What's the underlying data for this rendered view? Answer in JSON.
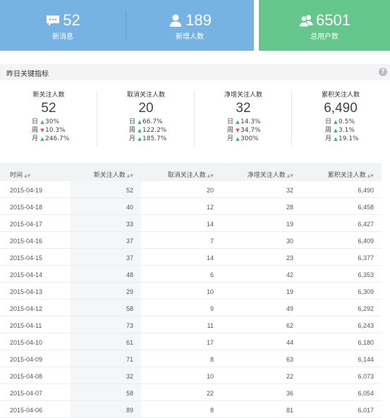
{
  "top_cards": [
    {
      "icon": "message-icon",
      "value": "52",
      "label": "新消息"
    },
    {
      "icon": "user-icon",
      "value": "189",
      "label": "新增人数"
    },
    {
      "icon": "users-icon",
      "value": "6501",
      "label": "总用户数"
    }
  ],
  "colors": {
    "blue_card": "#76b3e2",
    "green_card": "#66c78c",
    "up": "#3cb36b",
    "down": "#e04b4b"
  },
  "kpi_section": {
    "title": "昨日关键指标",
    "help": "?",
    "metrics": [
      {
        "name": "新关注人数",
        "value": "52",
        "rows": [
          {
            "label": "日",
            "dir": "up",
            "pct": "30%"
          },
          {
            "label": "周",
            "dir": "down",
            "pct": "10.3%"
          },
          {
            "label": "月",
            "dir": "up",
            "pct": "246.7%"
          }
        ]
      },
      {
        "name": "取消关注人数",
        "value": "20",
        "rows": [
          {
            "label": "日",
            "dir": "up",
            "pct": "66.7%"
          },
          {
            "label": "周",
            "dir": "up",
            "pct": "122.2%"
          },
          {
            "label": "月",
            "dir": "up",
            "pct": "185.7%"
          }
        ]
      },
      {
        "name": "净增关注人数",
        "value": "32",
        "rows": [
          {
            "label": "日",
            "dir": "up",
            "pct": "14.3%"
          },
          {
            "label": "周",
            "dir": "down",
            "pct": "34.7%"
          },
          {
            "label": "月",
            "dir": "up",
            "pct": "300%"
          }
        ]
      },
      {
        "name": "累积关注人数",
        "value": "6,490",
        "rows": [
          {
            "label": "日",
            "dir": "up",
            "pct": "0.5%"
          },
          {
            "label": "周",
            "dir": "up",
            "pct": "3.1%"
          },
          {
            "label": "月",
            "dir": "up",
            "pct": "19.1%"
          }
        ]
      }
    ]
  },
  "table": {
    "headers": [
      "时间",
      "新关注人数",
      "取消关注人数",
      "净增关注人数",
      "累积关注人数"
    ],
    "rows": [
      [
        "2015-04-19",
        "52",
        "20",
        "32",
        "6,490"
      ],
      [
        "2015-04-18",
        "40",
        "12",
        "28",
        "6,458"
      ],
      [
        "2015-04-17",
        "33",
        "14",
        "19",
        "6,427"
      ],
      [
        "2015-04-16",
        "37",
        "7",
        "30",
        "6,409"
      ],
      [
        "2015-04-15",
        "37",
        "14",
        "23",
        "6,377"
      ],
      [
        "2015-04-14",
        "48",
        "6",
        "42",
        "6,353"
      ],
      [
        "2015-04-13",
        "29",
        "10",
        "19",
        "6,309"
      ],
      [
        "2015-04-12",
        "58",
        "9",
        "49",
        "6,292"
      ],
      [
        "2015-04-11",
        "73",
        "11",
        "62",
        "6,243"
      ],
      [
        "2015-04-10",
        "61",
        "17",
        "44",
        "6,180"
      ],
      [
        "2015-04-09",
        "71",
        "8",
        "63",
        "6,144"
      ],
      [
        "2015-04-08",
        "32",
        "10",
        "22",
        "6,073"
      ],
      [
        "2015-04-07",
        "58",
        "22",
        "36",
        "6,054"
      ],
      [
        "2015-04-06",
        "89",
        "8",
        "81",
        "6,017"
      ]
    ]
  }
}
